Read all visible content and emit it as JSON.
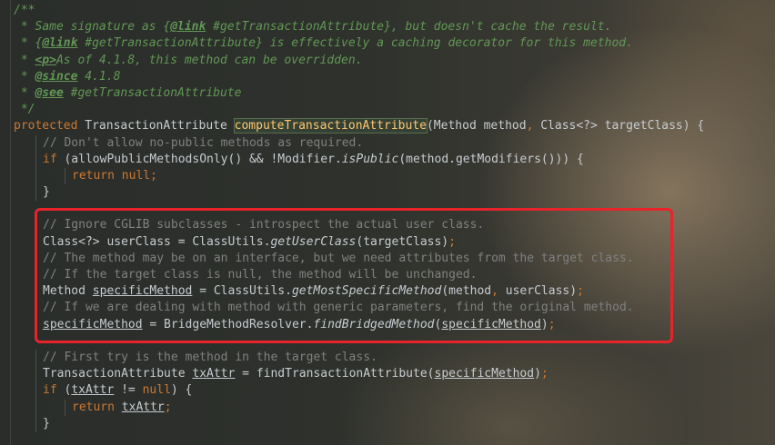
{
  "code": {
    "lines": [
      {
        "indent": 0,
        "tokens": [
          {
            "c": "doc",
            "t": "/**"
          }
        ]
      },
      {
        "indent": 0,
        "tokens": [
          {
            "c": "doc",
            "t": " * Same signature as {"
          },
          {
            "c": "tag",
            "t": "@link"
          },
          {
            "c": "doc",
            "t": " #getTransactionAttribute}, but doesn't cache the result."
          }
        ]
      },
      {
        "indent": 0,
        "tokens": [
          {
            "c": "doc",
            "t": " * {"
          },
          {
            "c": "tag",
            "t": "@link"
          },
          {
            "c": "doc",
            "t": " #getTransactionAttribute} is effectively a caching decorator for this method."
          }
        ]
      },
      {
        "indent": 0,
        "tokens": [
          {
            "c": "doc",
            "t": " * "
          },
          {
            "c": "tag",
            "t": "<p>"
          },
          {
            "c": "doc",
            "t": "As of 4.1.8, this method can be overridden."
          }
        ]
      },
      {
        "indent": 0,
        "tokens": [
          {
            "c": "doc",
            "t": " * "
          },
          {
            "c": "tag",
            "t": "@since"
          },
          {
            "c": "doc",
            "t": " 4.1.8"
          }
        ]
      },
      {
        "indent": 0,
        "tokens": [
          {
            "c": "doc",
            "t": " * "
          },
          {
            "c": "tag",
            "t": "@see"
          },
          {
            "c": "doc",
            "t": " #getTransactionAttribute"
          }
        ]
      },
      {
        "indent": 0,
        "tokens": [
          {
            "c": "doc",
            "t": " */"
          }
        ]
      },
      {
        "indent": 0,
        "tokens": [
          {
            "c": "kw",
            "t": "protected "
          },
          {
            "c": "",
            "t": "TransactionAttribute "
          },
          {
            "c": "hl",
            "t": "computeTransactionAttribute"
          },
          {
            "c": "",
            "t": "(Method method"
          },
          {
            "c": "kw",
            "t": ", "
          },
          {
            "c": "",
            "t": "Class<?> targetClass) {"
          }
        ]
      },
      {
        "indent": 1,
        "tokens": [
          {
            "c": "cm",
            "t": "// Don't allow no-public methods as required."
          }
        ]
      },
      {
        "indent": 1,
        "tokens": [
          {
            "c": "kw",
            "t": "if "
          },
          {
            "c": "",
            "t": "(allowPublicMethodsOnly() && !Modifier."
          },
          {
            "c": "it",
            "t": "isPublic"
          },
          {
            "c": "",
            "t": "(method.getModifiers())) {"
          }
        ]
      },
      {
        "indent": 2,
        "tokens": [
          {
            "c": "kw",
            "t": "return null;"
          }
        ]
      },
      {
        "indent": 1,
        "tokens": [
          {
            "c": "",
            "t": "}"
          }
        ]
      },
      {
        "indent": 0,
        "tokens": []
      },
      {
        "indent": 1,
        "tokens": [
          {
            "c": "cm",
            "t": "// Ignore CGLIB subclasses - introspect the actual user class."
          }
        ]
      },
      {
        "indent": 1,
        "tokens": [
          {
            "c": "",
            "t": "Class<?> userClass = ClassUtils."
          },
          {
            "c": "it",
            "t": "getUserClass"
          },
          {
            "c": "",
            "t": "(targetClass)"
          },
          {
            "c": "kw",
            "t": ";"
          }
        ]
      },
      {
        "indent": 1,
        "tokens": [
          {
            "c": "cm",
            "t": "// The method may be on an interface, but we need attributes from the target class."
          }
        ]
      },
      {
        "indent": 1,
        "tokens": [
          {
            "c": "cm",
            "t": "// If the target class is null, the method will be unchanged."
          }
        ]
      },
      {
        "indent": 1,
        "tokens": [
          {
            "c": "",
            "t": "Method "
          },
          {
            "c": "ul",
            "t": "specificMethod"
          },
          {
            "c": "",
            "t": " = ClassUtils."
          },
          {
            "c": "it",
            "t": "getMostSpecificMethod"
          },
          {
            "c": "",
            "t": "(method"
          },
          {
            "c": "kw",
            "t": ", "
          },
          {
            "c": "",
            "t": "userClass)"
          },
          {
            "c": "kw",
            "t": ";"
          }
        ]
      },
      {
        "indent": 1,
        "tokens": [
          {
            "c": "cm",
            "t": "// If we are dealing with method with generic parameters, find the original method."
          }
        ]
      },
      {
        "indent": 1,
        "tokens": [
          {
            "c": "ul",
            "t": "specificMethod"
          },
          {
            "c": "",
            "t": " = BridgeMethodResolver."
          },
          {
            "c": "it",
            "t": "findBridgedMethod"
          },
          {
            "c": "",
            "t": "("
          },
          {
            "c": "ul",
            "t": "specificMethod"
          },
          {
            "c": "",
            "t": ")"
          },
          {
            "c": "kw",
            "t": ";"
          }
        ]
      },
      {
        "indent": 0,
        "tokens": []
      },
      {
        "indent": 1,
        "tokens": [
          {
            "c": "cm",
            "t": "// First try is the method in the target class."
          }
        ]
      },
      {
        "indent": 1,
        "tokens": [
          {
            "c": "",
            "t": "TransactionAttribute "
          },
          {
            "c": "ul",
            "t": "txAttr"
          },
          {
            "c": "",
            "t": " = findTransactionAttribute("
          },
          {
            "c": "ul",
            "t": "specificMethod"
          },
          {
            "c": "",
            "t": ")"
          },
          {
            "c": "kw",
            "t": ";"
          }
        ]
      },
      {
        "indent": 1,
        "tokens": [
          {
            "c": "kw",
            "t": "if "
          },
          {
            "c": "",
            "t": "("
          },
          {
            "c": "ul",
            "t": "txAttr"
          },
          {
            "c": "",
            "t": " != "
          },
          {
            "c": "kw",
            "t": "null"
          },
          {
            "c": "",
            "t": ") {"
          }
        ]
      },
      {
        "indent": 2,
        "tokens": [
          {
            "c": "kw",
            "t": "return "
          },
          {
            "c": "ul",
            "t": "txAttr"
          },
          {
            "c": "kw",
            "t": ";"
          }
        ]
      },
      {
        "indent": 1,
        "tokens": [
          {
            "c": "",
            "t": "}"
          }
        ]
      }
    ]
  },
  "colors": {
    "keyword": "#cc7832",
    "comment": "#808080",
    "javadoc": "#629755",
    "method_highlight": "#ffc66d",
    "annotation_box": "#e8232a"
  }
}
